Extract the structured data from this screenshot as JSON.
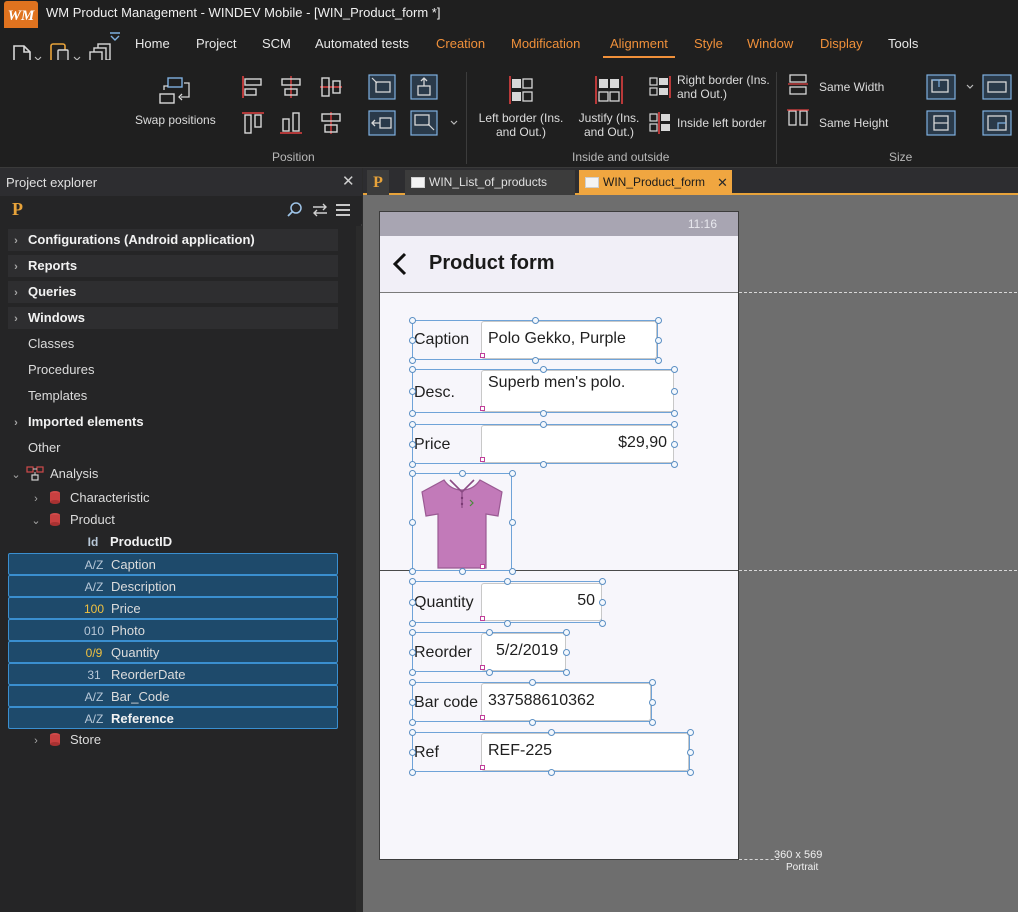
{
  "app": {
    "title": "WM Product Management - WINDEV Mobile - [WIN_Product_form *]",
    "logo_text": "WM"
  },
  "menu": {
    "items": [
      {
        "label": "Home",
        "style": "normal"
      },
      {
        "label": "Project",
        "style": "normal"
      },
      {
        "label": "SCM",
        "style": "normal"
      },
      {
        "label": "Automated tests",
        "style": "normal"
      },
      {
        "label": "Creation",
        "style": "orange"
      },
      {
        "label": "Modification",
        "style": "orange"
      },
      {
        "label": "Alignment",
        "style": "active"
      },
      {
        "label": "Style",
        "style": "orange"
      },
      {
        "label": "Window",
        "style": "orange"
      },
      {
        "label": "Display",
        "style": "orange"
      },
      {
        "label": "Tools",
        "style": "normal"
      }
    ]
  },
  "ribbon": {
    "swap_positions": "Swap positions",
    "left_border": "Left border (Ins.\nand Out.)",
    "justify": "Justify (Ins.\nand Out.)",
    "right_border": "Right border (Ins.\nand Out.)",
    "inside_left_border": "Inside left border",
    "same_width": "Same Width",
    "same_height": "Same Height",
    "group_position": "Position",
    "group_inside_outside": "Inside and outside",
    "group_size": "Size"
  },
  "explorer": {
    "title": "Project explorer",
    "close": "✕",
    "logo": "P",
    "items": [
      {
        "label": "Configurations (Android application)",
        "caret": "›",
        "bold": true,
        "folder": true,
        "indent": 0,
        "icon": ""
      },
      {
        "label": "Reports",
        "caret": "›",
        "bold": true,
        "folder": true,
        "indent": 0,
        "icon": ""
      },
      {
        "label": "Queries",
        "caret": "›",
        "bold": true,
        "folder": true,
        "indent": 0,
        "icon": ""
      },
      {
        "label": "Windows",
        "caret": "›",
        "bold": true,
        "folder": true,
        "indent": 0,
        "icon": ""
      },
      {
        "label": "Classes",
        "caret": "",
        "bold": false,
        "folder": false,
        "indent": 0,
        "icon": ""
      },
      {
        "label": "Procedures",
        "caret": "",
        "bold": false,
        "folder": false,
        "indent": 0,
        "icon": ""
      },
      {
        "label": "Templates",
        "caret": "",
        "bold": false,
        "folder": false,
        "indent": 0,
        "icon": ""
      },
      {
        "label": "Imported elements",
        "caret": "›",
        "bold": true,
        "folder": false,
        "indent": 0,
        "icon": ""
      },
      {
        "label": "Other",
        "caret": "",
        "bold": false,
        "folder": false,
        "indent": 0,
        "icon": ""
      },
      {
        "label": "Analysis",
        "caret": "⌄",
        "bold": false,
        "folder": false,
        "indent": 0,
        "icon": "analysis"
      },
      {
        "label": "Characteristic",
        "caret": "›",
        "bold": false,
        "folder": false,
        "indent": 1,
        "icon": "table"
      },
      {
        "label": "Product",
        "caret": "⌄",
        "bold": false,
        "folder": false,
        "indent": 1,
        "icon": "table"
      },
      {
        "label": "ProductID",
        "caret": "",
        "bold": true,
        "folder": false,
        "indent": 2,
        "icon": "Id"
      },
      {
        "label": "Caption",
        "caret": "",
        "bold": false,
        "folder": false,
        "indent": 2,
        "icon": "A/Z",
        "selected": true
      },
      {
        "label": "Description",
        "caret": "",
        "bold": false,
        "folder": false,
        "indent": 2,
        "icon": "A/Z",
        "selected": true
      },
      {
        "label": "Price",
        "caret": "",
        "bold": false,
        "folder": false,
        "indent": 2,
        "icon": "100",
        "selected": true
      },
      {
        "label": "Photo",
        "caret": "",
        "bold": false,
        "folder": false,
        "indent": 2,
        "icon": "010",
        "selected": true
      },
      {
        "label": "Quantity",
        "caret": "",
        "bold": false,
        "folder": false,
        "indent": 2,
        "icon": "0/9",
        "selected": true
      },
      {
        "label": "ReorderDate",
        "caret": "",
        "bold": false,
        "folder": false,
        "indent": 2,
        "icon": "31",
        "selected": true
      },
      {
        "label": "Bar_Code",
        "caret": "",
        "bold": false,
        "folder": false,
        "indent": 2,
        "icon": "A/Z",
        "selected": true
      },
      {
        "label": "Reference",
        "caret": "",
        "bold": true,
        "folder": false,
        "indent": 2,
        "icon": "A/Z",
        "selected": true
      },
      {
        "label": "Store",
        "caret": "›",
        "bold": false,
        "folder": false,
        "indent": 1,
        "icon": "table"
      }
    ]
  },
  "tabs": {
    "project": "P",
    "list": "WIN_List_of_products",
    "form": "WIN_Product_form",
    "form_close": "✕"
  },
  "phone": {
    "time": "11:16",
    "title": "Product form",
    "fields": {
      "caption_label": "Caption",
      "caption_value": "Polo Gekko, Purple",
      "desc_label": "Desc.",
      "desc_value": "Superb men's polo.",
      "price_label": "Price",
      "price_value": "$29,90",
      "quantity_label": "Quantity",
      "quantity_value": "50",
      "reorder_label": "Reorder",
      "reorder_value": "5/2/2019",
      "barcode_label": "Bar code",
      "barcode_value": "337588610362",
      "ref_label": "Ref",
      "ref_value": "REF-225"
    },
    "size": "360 x 569",
    "orientation": "Portrait"
  },
  "colors": {
    "accent": "#f0903a",
    "selection": "#1e4a6b",
    "shirt": "#c26fb8"
  }
}
